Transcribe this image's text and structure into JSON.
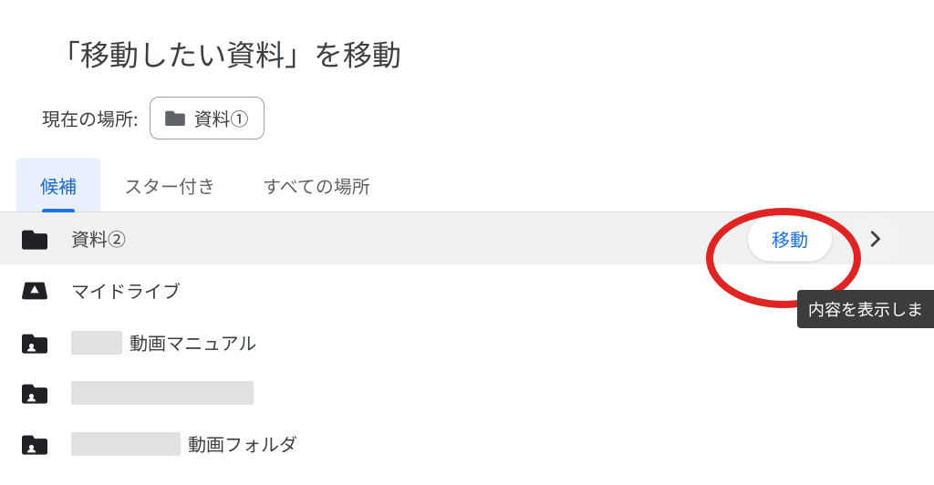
{
  "dialog": {
    "title": "「移動したい資料」を移動",
    "location_label": "現在の場所:",
    "current_location": "資料①"
  },
  "tabs": {
    "items": [
      {
        "label": "候補",
        "active": true
      },
      {
        "label": "スター付き",
        "active": false
      },
      {
        "label": "すべての場所",
        "active": false
      }
    ]
  },
  "list": {
    "rows": [
      {
        "icon": "folder",
        "name": "資料②",
        "hovered": true,
        "move_label": "移動",
        "has_chevron": true
      },
      {
        "icon": "drive",
        "name": "マイドライブ"
      },
      {
        "icon": "shared-drive",
        "name_suffix": "動画マニュアル",
        "redact_before_w": 56
      },
      {
        "icon": "shared-drive",
        "redact_before_w": 200
      },
      {
        "icon": "shared-drive",
        "name_suffix": "動画フォルダ",
        "redact_before_w": 120
      }
    ]
  },
  "tooltip": "内容を表示しま",
  "colors": {
    "accent": "#1a73e8",
    "annotation": "#e02424"
  }
}
